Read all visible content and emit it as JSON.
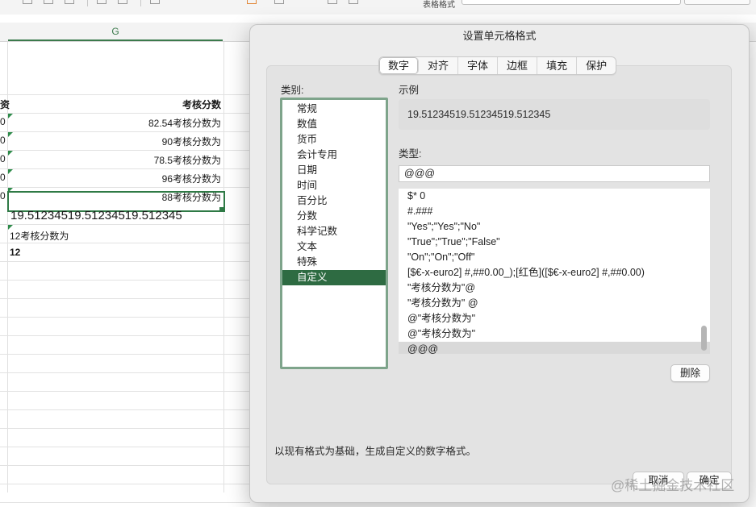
{
  "toolbar": {
    "table_format_label": "表格格式"
  },
  "sheet": {
    "column_header": "G",
    "left_partial_header": "资",
    "header": "考核分数",
    "left_digit": "0",
    "rows": [
      "82.54考核分数为",
      "90考核分数为",
      "78.5考核分数为",
      "96考核分数为",
      "88考核分数为"
    ],
    "selected_cell_value": "19.51234519.51234519.512345",
    "row_b": "12考核分数为",
    "row_c": "12"
  },
  "dialog": {
    "title": "设置单元格格式",
    "tabs": [
      "数字",
      "对齐",
      "字体",
      "边框",
      "填充",
      "保护"
    ],
    "active_tab": "数字",
    "category_label": "类别:",
    "categories": [
      "常规",
      "数值",
      "货币",
      "会计专用",
      "日期",
      "时间",
      "百分比",
      "分数",
      "科学记数",
      "文本",
      "特殊",
      "自定义"
    ],
    "selected_category": "自定义",
    "sample_label": "示例",
    "sample_value": "19.51234519.51234519.512345",
    "type_label": "类型:",
    "type_value": "@@@",
    "type_list": [
      "$* 0",
      "#.###",
      "\"Yes\";\"Yes\";\"No\"",
      "\"True\";\"True\";\"False\"",
      "\"On\";\"On\";\"Off\"",
      "[$€-x-euro2] #,##0.00_);[红色]([$€-x-euro2] #,##0.00)",
      "\"考核分数为\"@",
      "\"考核分数为\" @",
      "@\"考核分数为\"",
      "@\"考核分数为\"",
      "@@@"
    ],
    "selected_type": "@@@",
    "delete_button": "删除",
    "hint": "以现有格式为基础，生成自定义的数字格式。",
    "cancel_button": "取消",
    "ok_button": "确定"
  },
  "watermark": "@稀土掘金技术社区"
}
